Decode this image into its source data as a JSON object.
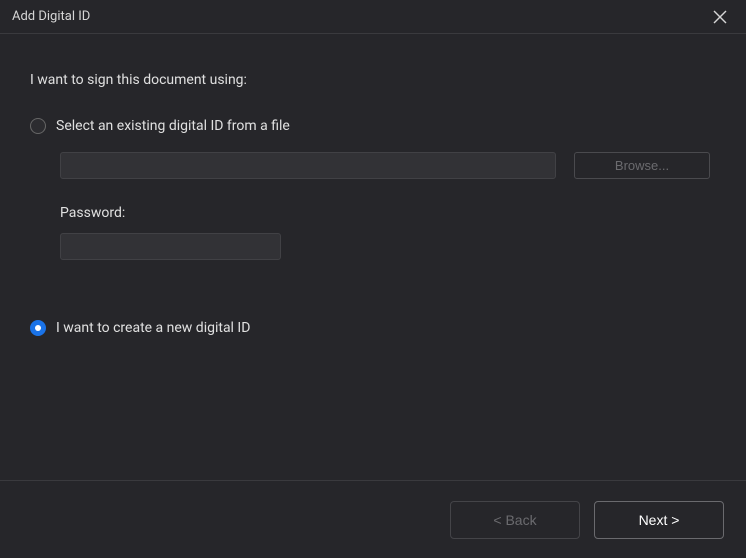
{
  "window": {
    "title": "Add Digital ID"
  },
  "prompt": "I want to sign this document using:",
  "options": {
    "existing": {
      "label": "Select an existing digital ID from a file",
      "selected": false,
      "file_value": "",
      "browse_label": "Browse...",
      "password_label": "Password:",
      "password_value": ""
    },
    "create": {
      "label": "I want to create a new digital ID",
      "selected": true
    }
  },
  "footer": {
    "back_label": "< Back",
    "next_label": "Next >"
  }
}
